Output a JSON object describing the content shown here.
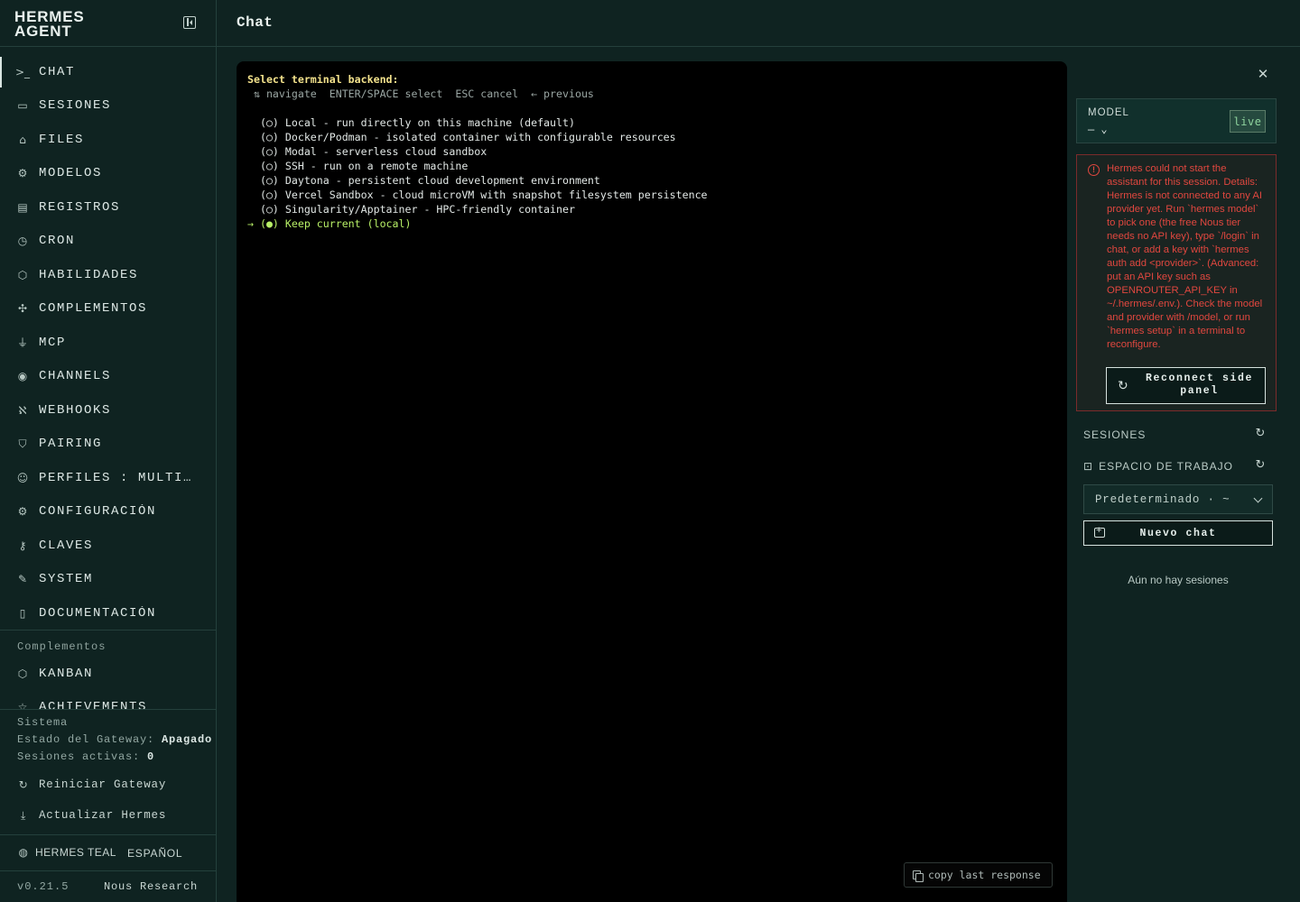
{
  "brand": {
    "line1": "HERMES",
    "line2": "AGENT"
  },
  "header": {
    "title": "Chat"
  },
  "sidebar": {
    "items": [
      {
        "label": "CHAT",
        "icon": "terminal-icon",
        "glyph": ">_",
        "active": true
      },
      {
        "label": "SESIONES",
        "icon": "message-square-icon",
        "glyph": "▭"
      },
      {
        "label": "FILES",
        "icon": "folder-icon",
        "glyph": "⌂"
      },
      {
        "label": "MODELOS",
        "icon": "cpu-icon",
        "glyph": "⚙"
      },
      {
        "label": "REGISTROS",
        "icon": "file-text-icon",
        "glyph": "▤"
      },
      {
        "label": "CRON",
        "icon": "clock-icon",
        "glyph": "◷"
      },
      {
        "label": "HABILIDADES",
        "icon": "package-icon",
        "glyph": "⬡"
      },
      {
        "label": "COMPLEMENTOS",
        "icon": "puzzle-icon",
        "glyph": "✣"
      },
      {
        "label": "MCP",
        "icon": "plug-icon",
        "glyph": "⏚"
      },
      {
        "label": "CHANNELS",
        "icon": "radio-icon",
        "glyph": "◉"
      },
      {
        "label": "WEBHOOKS",
        "icon": "webhook-icon",
        "glyph": "ℵ"
      },
      {
        "label": "PAIRING",
        "icon": "shield-icon",
        "glyph": "⛉"
      },
      {
        "label": "PERFILES : MULTI AGENTE",
        "icon": "users-icon",
        "glyph": "☺"
      },
      {
        "label": "CONFIGURACIÓN",
        "icon": "settings-icon",
        "glyph": "⚙"
      },
      {
        "label": "CLAVES",
        "icon": "key-icon",
        "glyph": "⚷"
      },
      {
        "label": "SYSTEM",
        "icon": "wrench-icon",
        "glyph": "✎"
      },
      {
        "label": "DOCUMENTACIÓN",
        "icon": "book-icon",
        "glyph": "▯"
      }
    ],
    "plugins_title": "Complementos",
    "plugins": [
      {
        "label": "KANBAN",
        "icon": "package-icon",
        "glyph": "⬡"
      },
      {
        "label": "ACHIEVEMENTS",
        "icon": "star-icon",
        "glyph": "☆"
      }
    ],
    "system": {
      "title": "Sistema",
      "gateway_label": "Estado del Gateway:",
      "gateway_value": "Apagado",
      "sessions_label": "Sesiones activas:",
      "sessions_value": "0",
      "restart_label": "Reiniciar Gateway",
      "update_label": "Actualizar Hermes"
    },
    "theme_label": "HERMES TEAL",
    "language_label": "ESPAÑOL",
    "version": "v0.21.5",
    "vendor": "Nous Research"
  },
  "terminal": {
    "prompt": "Select terminal backend:",
    "hint": " ⇅ navigate  ENTER/SPACE select  ESC cancel  ← previous",
    "options": [
      "  (○) Local - run directly on this machine (default)",
      "  (○) Docker/Podman - isolated container with configurable resources",
      "  (○) Modal - serverless cloud sandbox",
      "  (○) SSH - run on a remote machine",
      "  (○) Daytona - persistent cloud development environment",
      "  (○) Vercel Sandbox - cloud microVM with snapshot filesystem persistence",
      "  (○) Singularity/Apptainer - HPC-friendly container"
    ],
    "selected_option": "→ (●) Keep current (local)",
    "copy_label": "copy last response"
  },
  "right_panel": {
    "model_label": "MODEL",
    "model_value": "— ⌄",
    "live_label": "live",
    "error_message": "Hermes could not start the assistant for this session. Details: Hermes is not connected to any AI provider yet. Run `hermes model` to pick one (the free Nous tier needs no API key), type `/login` in chat, or add a key with `hermes auth add <provider>`. (Advanced: put an API key such as OPENROUTER_API_KEY in ~/.hermes/.env.). Check the model and provider with /model, or run `hermes setup` in a terminal to reconfigure.",
    "reconnect_label": "Reconnect side panel",
    "sessions_heading": "SESIONES",
    "workspace_heading": "ESPACIO DE TRABAJO",
    "workspace_value": "Predeterminado · ~",
    "new_chat_label": "Nuevo chat",
    "empty_sessions": "Aún no hay sesiones"
  }
}
